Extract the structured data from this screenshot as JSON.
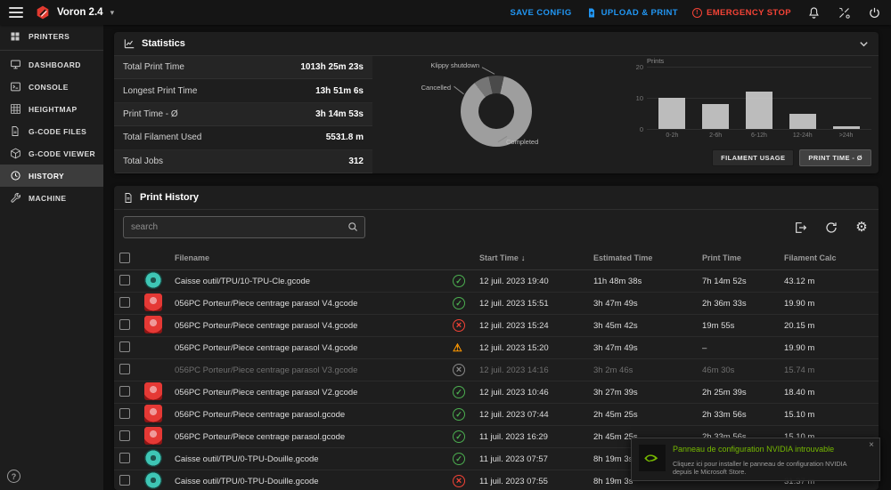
{
  "topbar": {
    "printer_name": "Voron 2.4",
    "save_config": "SAVE CONFIG",
    "upload_print": "UPLOAD & PRINT",
    "emergency_stop": "EMERGENCY STOP"
  },
  "icons": {
    "chevron_down": "▾",
    "sort_desc": "↓",
    "gear": "⚙",
    "help": "?",
    "close": "×",
    "estop": "!"
  },
  "sidebar": {
    "active": "HISTORY",
    "items": [
      {
        "label": "PRINTERS"
      },
      {
        "label": "DASHBOARD"
      },
      {
        "label": "CONSOLE"
      },
      {
        "label": "HEIGHTMAP"
      },
      {
        "label": "G-CODE FILES"
      },
      {
        "label": "G-CODE VIEWER"
      },
      {
        "label": "HISTORY"
      },
      {
        "label": "MACHINE"
      }
    ]
  },
  "statistics": {
    "title": "Statistics",
    "rows": [
      {
        "label": "Total Print Time",
        "value": "1013h 25m 23s"
      },
      {
        "label": "Longest Print Time",
        "value": "13h 51m 6s"
      },
      {
        "label": "Print Time - Ø",
        "value": "3h 14m 53s"
      },
      {
        "label": "Total Filament Used",
        "value": "5531.8 m"
      },
      {
        "label": "Total Jobs",
        "value": "312"
      }
    ],
    "buttons": [
      "FILAMENT USAGE",
      "PRINT TIME - Ø"
    ],
    "active_button": "PRINT TIME - Ø"
  },
  "chart_data": [
    {
      "type": "pie",
      "labels": [
        "Klippy shutdown",
        "Cancelled",
        "Completed"
      ],
      "values_pct": [
        7,
        7,
        86
      ],
      "colors": [
        "#4a4a4a",
        "#757575",
        "#9e9e9e"
      ]
    },
    {
      "type": "bar",
      "ylabel": "Prints",
      "categories": [
        "0-2h",
        "2-6h",
        "6-12h",
        "12-24h",
        ">24h"
      ],
      "values": [
        10,
        8,
        12,
        5,
        1
      ],
      "ylim": [
        0,
        20
      ],
      "yticks": [
        0,
        10,
        20
      ],
      "bar_color": "#d8d8d8"
    }
  ],
  "history": {
    "title": "Print History",
    "search_placeholder": "search",
    "columns": {
      "filename": "Filename",
      "start_time": "Start Time",
      "estimated_time": "Estimated Time",
      "print_time": "Print Time",
      "filament_calc": "Filament Calc"
    },
    "rows": [
      {
        "filename": "Caisse outil/TPU/10-TPU-Cle.gcode",
        "status": "completed",
        "start": "12 juil. 2023 19:40",
        "estimated": "11h 48m 38s",
        "print": "7h 14m 52s",
        "filament": "43.12 m",
        "thumb": "teal",
        "dimmed": false
      },
      {
        "filename": "056PC Porteur/Piece centrage parasol V4.gcode",
        "status": "completed",
        "start": "12 juil. 2023 15:51",
        "estimated": "3h 47m 49s",
        "print": "2h 36m 33s",
        "filament": "19.90 m",
        "thumb": "red",
        "dimmed": false
      },
      {
        "filename": "056PC Porteur/Piece centrage parasol V4.gcode",
        "status": "cancelled",
        "start": "12 juil. 2023 15:24",
        "estimated": "3h 45m 42s",
        "print": "19m 55s",
        "filament": "20.15 m",
        "thumb": "red",
        "dimmed": false
      },
      {
        "filename": "056PC Porteur/Piece centrage parasol V4.gcode",
        "status": "warning",
        "start": "12 juil. 2023 15:20",
        "estimated": "3h 47m 49s",
        "print": "–",
        "filament": "19.90 m",
        "thumb": "none",
        "dimmed": false
      },
      {
        "filename": "056PC Porteur/Piece centrage parasol V3.gcode",
        "status": "shutdown",
        "start": "12 juil. 2023 14:16",
        "estimated": "3h 2m 46s",
        "print": "46m 30s",
        "filament": "15.74 m",
        "thumb": "none",
        "dimmed": true
      },
      {
        "filename": "056PC Porteur/Piece centrage parasol V2.gcode",
        "status": "completed",
        "start": "12 juil. 2023 10:46",
        "estimated": "3h 27m 39s",
        "print": "2h 25m 39s",
        "filament": "18.40 m",
        "thumb": "red",
        "dimmed": false
      },
      {
        "filename": "056PC Porteur/Piece centrage parasol.gcode",
        "status": "completed",
        "start": "12 juil. 2023 07:44",
        "estimated": "2h 45m 25s",
        "print": "2h 33m 56s",
        "filament": "15.10 m",
        "thumb": "red",
        "dimmed": false
      },
      {
        "filename": "056PC Porteur/Piece centrage parasol.gcode",
        "status": "completed",
        "start": "11 juil. 2023 16:29",
        "estimated": "2h 45m 25s",
        "print": "2h 33m 56s",
        "filament": "15.10 m",
        "thumb": "red",
        "dimmed": false
      },
      {
        "filename": "Caisse outil/TPU/0-TPU-Douille.gcode",
        "status": "completed",
        "start": "11 juil. 2023 07:57",
        "estimated": "8h 19m 3s",
        "print": "",
        "filament": "",
        "thumb": "teal",
        "dimmed": false
      },
      {
        "filename": "Caisse outil/TPU/0-TPU-Douille.gcode",
        "status": "cancelled",
        "start": "11 juil. 2023 07:55",
        "estimated": "8h 19m 3s",
        "print": "",
        "filament": "31.37 m",
        "thumb": "teal",
        "dimmed": false
      }
    ]
  },
  "notification": {
    "title": "Panneau de configuration NVIDIA introuvable",
    "body": "Cliquez ici pour installer le panneau de configuration NVIDIA depuis le Microsoft Store."
  }
}
